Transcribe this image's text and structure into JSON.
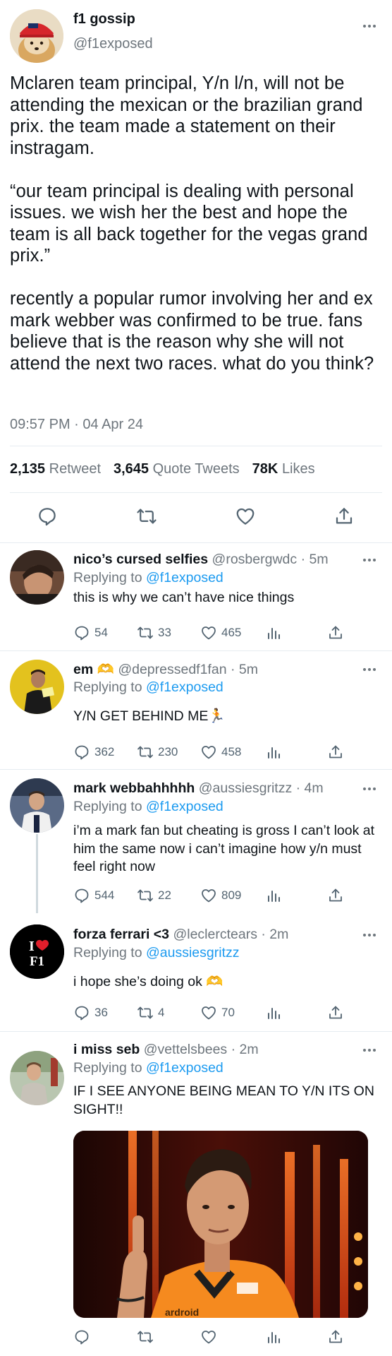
{
  "tweet": {
    "name": "f1 gossip",
    "handle": "@f1exposed",
    "text": "Mclaren team principal, Y/n l/n, will not be attending the mexican or the brazilian grand prix. the team made a statement on their instragam.\n\n“our team principal is dealing with personal issues. we wish her the best and hope the team is all back together for the vegas grand prix.”\n\nrecently a popular rumor involving her and ex mark webber was confirmed to be true. fans believe that is the reason why she will not attend the next two races. what do you think?",
    "timestamp": "09:57 PM · 04 Apr 24",
    "retweets": "2,135",
    "retweets_label": "Retweet",
    "quotes": "3,645",
    "quotes_label": "Quote Tweets",
    "likes": "78K",
    "likes_label": "Likes"
  },
  "replies": [
    {
      "name": "nico’s cursed selfies",
      "handle": "@rosbergwdc",
      "time": "· 5m",
      "replying_prefix": "Replying to",
      "replying_to": "@f1exposed",
      "text": "this is why we can’t have nice things",
      "replies": "54",
      "retweets": "33",
      "likes": "465"
    },
    {
      "name": "em 🫶",
      "handle": "@depressedf1fan",
      "time": "· 5m",
      "replying_prefix": "Replying to",
      "replying_to": "@f1exposed",
      "text": "Y/N GET BEHIND ME🏃",
      "replies": "362",
      "retweets": "230",
      "likes": "458"
    },
    {
      "name": "mark webbahhhhh",
      "handle": "@aussiesgritzz",
      "time": "· 4m",
      "replying_prefix": "Replying to",
      "replying_to": "@f1exposed",
      "text": "i’m a mark fan but cheating is gross I can’t look at him the same now i can’t imagine how y/n must feel right now",
      "replies": "544",
      "retweets": "22",
      "likes": "809"
    },
    {
      "name": "forza ferrari <3",
      "handle": "@leclerctears",
      "time": "· 2m",
      "replying_prefix": "Replying to",
      "replying_to": "@aussiesgritzz",
      "text": "i hope she’s doing ok 🫶",
      "replies": "36",
      "retweets": "4",
      "likes": "70",
      "avatar_line1": "I",
      "avatar_line2": "F1"
    },
    {
      "name": "i miss seb",
      "handle": "@vettelsbees",
      "time": "· 2m",
      "replying_prefix": "Replying to",
      "replying_to": "@f1exposed",
      "text": "IF I SEE ANYONE BEING MEAN TO Y/N ITS ON SIGHT!!",
      "replies": "",
      "retweets": "",
      "likes": "",
      "media_text": "ardroid"
    }
  ],
  "icons": {
    "reply": "speech-bubble-icon",
    "retweet": "retweet-icon",
    "like": "heart-icon",
    "share": "share-upload-icon",
    "analytics": "analytics-bars-icon",
    "more": "more-dots-icon"
  }
}
